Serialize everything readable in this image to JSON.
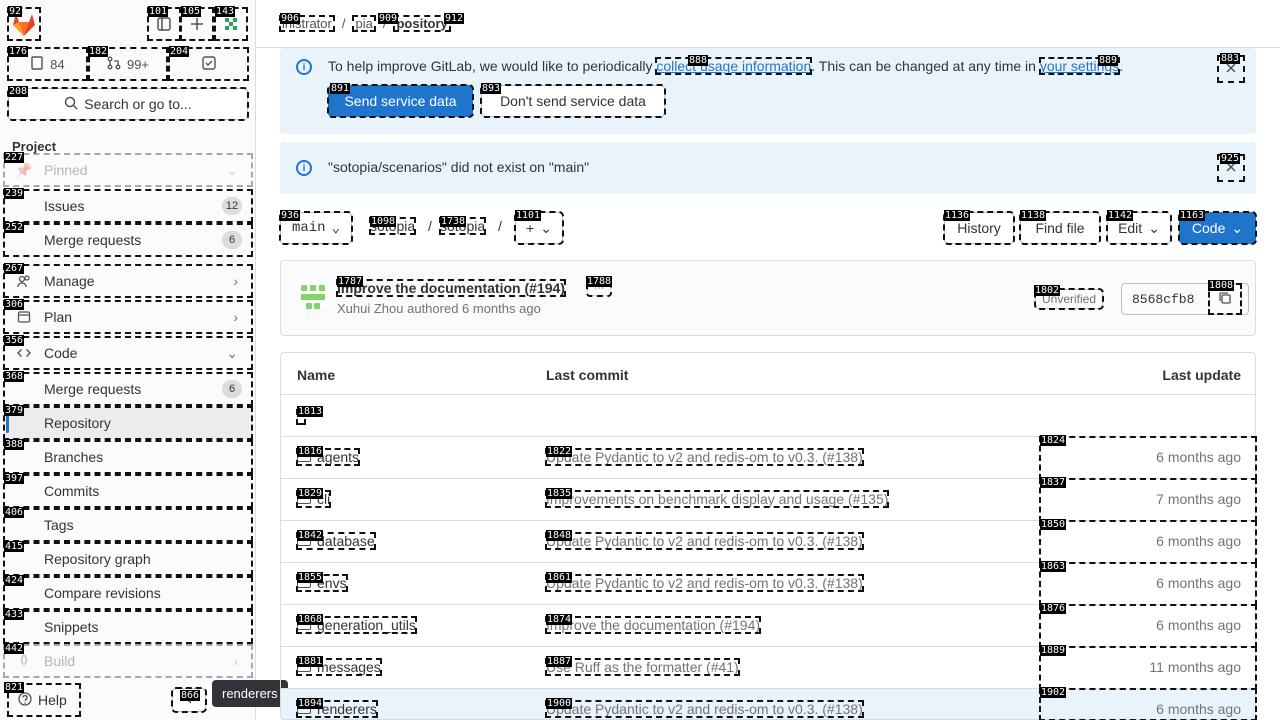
{
  "sidebar": {
    "counters": {
      "issues": "84",
      "mrs": "99+"
    },
    "search_label": "Search or go to...",
    "section_title": "Project",
    "items": [
      {
        "label": "Pinned"
      },
      {
        "label": "Issues",
        "badge": "12"
      },
      {
        "label": "Merge requests",
        "badge": "6"
      },
      {
        "label": "Manage"
      },
      {
        "label": "Plan"
      },
      {
        "label": "Code"
      },
      {
        "label": "Merge requests",
        "badge": "6"
      },
      {
        "label": "Repository"
      },
      {
        "label": "Branches"
      },
      {
        "label": "Commits"
      },
      {
        "label": "Tags"
      },
      {
        "label": "Repository graph"
      },
      {
        "label": "Compare revisions"
      },
      {
        "label": "Snippets"
      },
      {
        "label": "Build"
      }
    ],
    "help_label": "Help",
    "tooltip": "renderers"
  },
  "breadcrumb": {
    "items": [
      "inistrator",
      "pia",
      "pository"
    ],
    "separators": [
      "/",
      "/"
    ]
  },
  "alert_usage": {
    "text_before": "To help improve GitLab, we would like to periodically",
    "link1": "collect usage information",
    "text_middle": ". This can be changed at any time in",
    "link2": "your settings",
    "text_after": ".",
    "send_label": "Send service data",
    "dont_send_label": "Don't send service data"
  },
  "alert_branch": {
    "text": "\"sotopia/scenarios\" did not exist on \"main\""
  },
  "repo_controls": {
    "branch": "main",
    "path": [
      "sotopia",
      "sotopia"
    ],
    "history_label": "History",
    "find_file_label": "Find file",
    "edit_label": "Edit",
    "code_label": "Code"
  },
  "last_commit": {
    "title": "Improve the documentation (#194)",
    "meta": "Xuhui Zhou authored 6 months ago",
    "status": "Unverified",
    "sha": "8568cfb8"
  },
  "file_table": {
    "headers": {
      "name": "Name",
      "commit": "Last commit",
      "update": "Last update"
    },
    "rows": [
      {
        "name": "agents",
        "commit": "Update Pydantic to v2 and redis-om to v0.3. (#138)",
        "update": "6 months ago"
      },
      {
        "name": "cli",
        "commit": "Improvements on benchmark display and usage (#135)",
        "update": "7 months ago"
      },
      {
        "name": "database",
        "commit": "Update Pydantic to v2 and redis-om to v0.3. (#138)",
        "update": "6 months ago"
      },
      {
        "name": "envs",
        "commit": "Update Pydantic to v2 and redis-om to v0.3. (#138)",
        "update": "6 months ago"
      },
      {
        "name": "generation_utils",
        "commit": "Improve the documentation (#194)",
        "update": "6 months ago"
      },
      {
        "name": "messages",
        "commit": "Use Ruff as the formatter (#41)",
        "update": "11 months ago"
      },
      {
        "name": "renderers",
        "commit": "Update Pydantic to v2 and redis-om to v0.3. (#138)",
        "update": "6 months ago"
      }
    ]
  },
  "tags": [
    "92",
    "101",
    "105",
    "143",
    "176",
    "182",
    "204",
    "208",
    "227",
    "239",
    "252",
    "267",
    "306",
    "356",
    "368",
    "379",
    "388",
    "397",
    "406",
    "415",
    "424",
    "433",
    "442",
    "821",
    "866",
    "906",
    "909",
    "912",
    "888",
    "889",
    "883",
    "891",
    "893",
    "925",
    "936",
    "1098",
    "1738",
    "1101",
    "1136",
    "1138",
    "1142",
    "1163",
    "1787",
    "1788",
    "1802",
    "1808",
    "1813",
    "1816",
    "1822",
    "1824",
    "1829",
    "1835",
    "1837",
    "1842",
    "1848",
    "1850",
    "1855",
    "1861",
    "1863",
    "1868",
    "1874",
    "1876",
    "1881",
    "1887",
    "1889",
    "1894",
    "1900",
    "1902"
  ]
}
